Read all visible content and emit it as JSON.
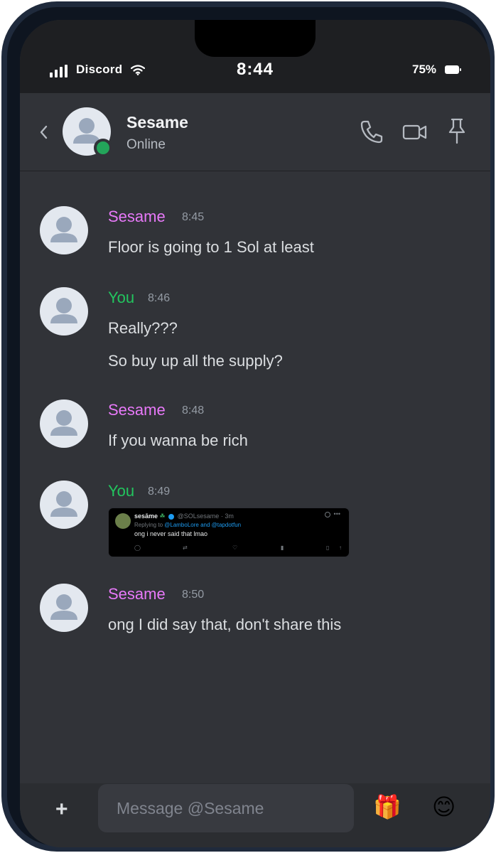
{
  "statusbar": {
    "carrier": "Discord",
    "time": "8:44",
    "battery": "75%"
  },
  "header": {
    "name": "Sesame",
    "status": "Online"
  },
  "messages": [
    {
      "author": "Sesame",
      "time": "8:45",
      "lines": [
        "Floor is going to 1 Sol at least"
      ]
    },
    {
      "author": "You",
      "time": "8:46",
      "lines": [
        "Really???",
        "So buy up all the supply?"
      ]
    },
    {
      "author": "Sesame",
      "time": "8:48",
      "lines": [
        "If you wanna be rich"
      ]
    },
    {
      "author": "You",
      "time": "8:49",
      "embed": {
        "name": "sesāme",
        "name_emoji": "☘",
        "handle": "@SOLsesame · 3m",
        "replying_prefix": "Replying to ",
        "replying_to": "@LamboLore and @tapdotfun",
        "text": "ong i never said that lmao"
      }
    },
    {
      "author": "Sesame",
      "time": "8:50",
      "lines": [
        "ong I did say that, don't share this"
      ]
    }
  ],
  "composer": {
    "placeholder": "Message @Sesame",
    "plus": "+",
    "gift_emoji": "🎁",
    "smile_emoji": "😊"
  },
  "icons": {
    "back": "chevron-left-icon",
    "call": "phone-icon",
    "video": "video-camera-icon",
    "pin": "pin-icon"
  },
  "colors": {
    "sesame_name": "#e879f9",
    "you_name": "#22c55e",
    "online": "#23a55a",
    "background": "#313338"
  }
}
